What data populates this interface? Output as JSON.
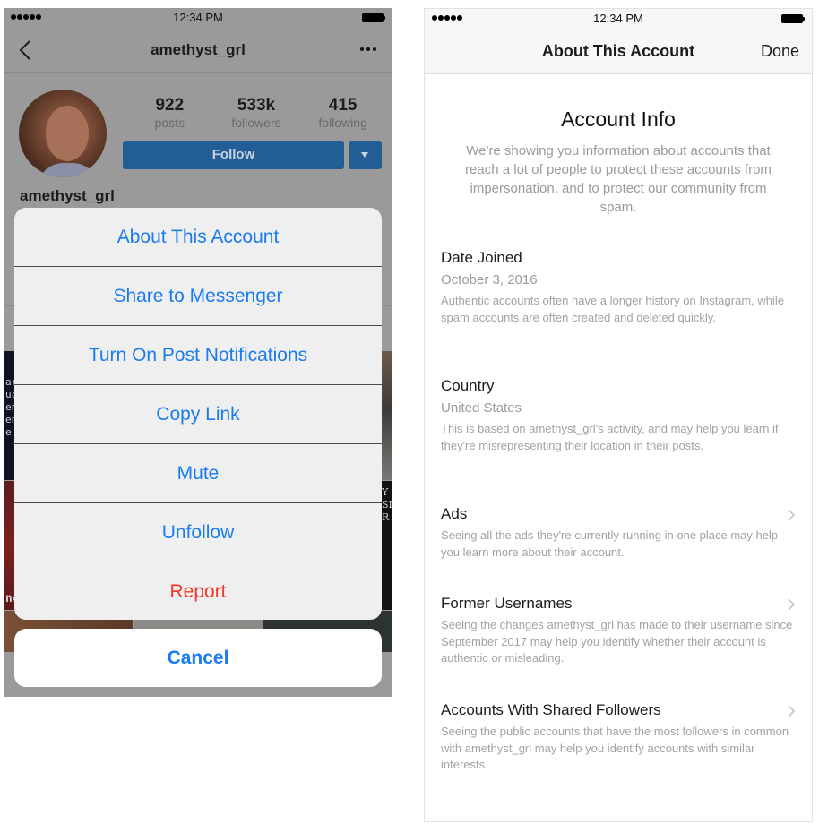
{
  "left_screen": {
    "status_bar": {
      "time": "12:34 PM",
      "signal_icon": "signal-dots-icon",
      "battery_icon": "battery-full-icon"
    },
    "nav": {
      "title": "amethyst_grl",
      "back_icon": "chevron-left-icon",
      "more_icon": "more-horizontal-icon"
    },
    "profile": {
      "username": "amethyst_grl",
      "stats": [
        {
          "value": "922",
          "label": "posts"
        },
        {
          "value": "533k",
          "label": "followers"
        },
        {
          "value": "415",
          "label": "following"
        }
      ],
      "follow_label": "Follow",
      "follow_dropdown_icon": "caret-down-icon",
      "accent_color": "#225e96"
    },
    "action_sheet": {
      "items": [
        {
          "label": "About This Account",
          "style": "default"
        },
        {
          "label": "Share to Messenger",
          "style": "default"
        },
        {
          "label": "Turn On Post Notifications",
          "style": "default"
        },
        {
          "label": "Copy Link",
          "style": "default"
        },
        {
          "label": "Mute",
          "style": "default"
        },
        {
          "label": "Unfollow",
          "style": "default"
        },
        {
          "label": "Report",
          "style": "destructive"
        }
      ],
      "cancel_label": "Cancel",
      "action_color": "#1a7cf0",
      "destructive_color": "#f0382a"
    }
  },
  "right_screen": {
    "status_bar": {
      "time": "12:34 PM",
      "signal_icon": "signal-dots-icon",
      "battery_icon": "battery-full-icon"
    },
    "nav": {
      "title": "About This Account",
      "done_label": "Done"
    },
    "header": {
      "title": "Account Info",
      "description": "We're showing you information about accounts that reach a lot of people to protect these accounts from impersonation, and to protect our community from spam."
    },
    "sections": [
      {
        "title": "Date Joined",
        "value": "October 3, 2016",
        "description": "Authentic accounts often have a longer history on Instagram, while spam accounts are often created and deleted quickly."
      },
      {
        "title": "Country",
        "value": "United States",
        "description": "This is based on amethyst_grl's activity, and may help you learn if they're misrepresenting their location in their posts."
      },
      {
        "title": "Ads",
        "description": "Seeing all the ads they're currently running in one place may help you learn more about their account.",
        "icon": "chevron-right-icon"
      },
      {
        "title": "Former Usernames",
        "description": "Seeing the changes amethyst_grl has made to their username since September 2017 may help you identify whether their account is authentic or misleading.",
        "icon": "chevron-right-icon"
      },
      {
        "title": "Accounts With Shared Followers",
        "description": "Seeing the public accounts that have the most followers in common with amethyst_grl may help you identify accounts with similar interests.",
        "icon": "chevron-right-icon"
      }
    ]
  }
}
